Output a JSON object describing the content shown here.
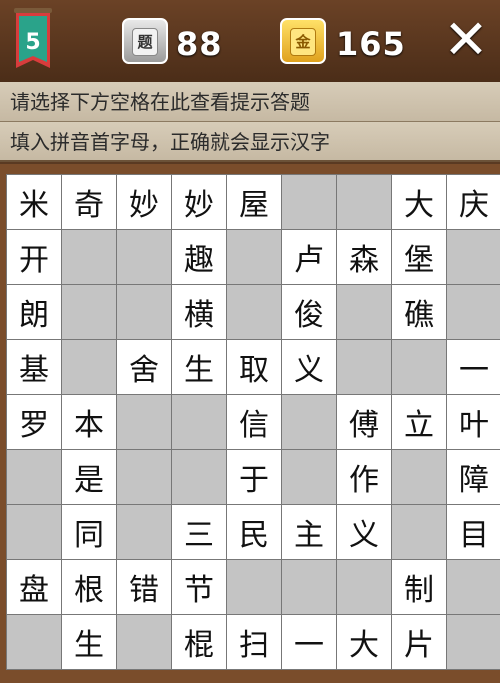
{
  "header": {
    "level": "5",
    "hint_badge_char": "题",
    "hint_count": "88",
    "gold_badge_char": "金",
    "gold_count": "165",
    "close_label": "✕"
  },
  "colors": {
    "bar_bg": "#5a3a22",
    "hint_bg": "#cfc3ad",
    "cell_filled": "#ffffff",
    "cell_empty": "#c4c4c4",
    "banner_red": "#d83c3c",
    "banner_green": "#2aa38a"
  },
  "hints": {
    "line1": "请选择下方空格在此查看提示答题",
    "line2": "填入拼音首字母，正确就会显示汉字"
  },
  "grid": [
    [
      "米",
      "奇",
      "妙",
      "妙",
      "屋",
      "",
      "",
      "大",
      "庆"
    ],
    [
      "开",
      "",
      "",
      "趣",
      "",
      "卢",
      "森",
      "堡",
      ""
    ],
    [
      "朗",
      "",
      "",
      "横",
      "",
      "俊",
      "",
      "礁",
      ""
    ],
    [
      "基",
      "",
      "舍",
      "生",
      "取",
      "义",
      "",
      "",
      "一"
    ],
    [
      "罗",
      "本",
      "",
      "",
      "信",
      "",
      "傅",
      "立",
      "叶"
    ],
    [
      "",
      "是",
      "",
      "",
      "于",
      "",
      "作",
      "",
      "障"
    ],
    [
      "",
      "同",
      "",
      "三",
      "民",
      "主",
      "义",
      "",
      "目"
    ],
    [
      "盘",
      "根",
      "错",
      "节",
      "",
      "",
      "",
      "制",
      ""
    ],
    [
      "",
      "生",
      "",
      "棍",
      "扫",
      "一",
      "大",
      "片",
      ""
    ]
  ]
}
